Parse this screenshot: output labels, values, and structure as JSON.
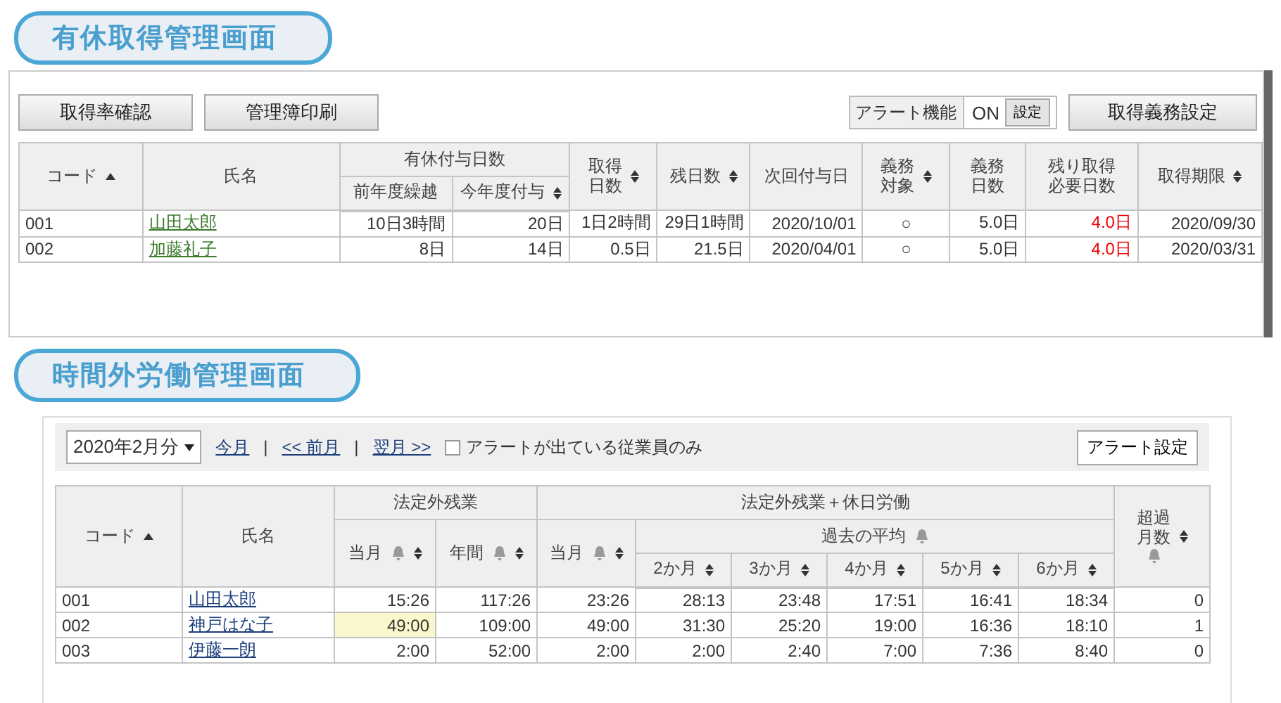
{
  "leave_screen": {
    "title": "有休取得管理画面",
    "buttons": [
      "取得率確認",
      "管理簿印刷"
    ],
    "alert_toggle": {
      "label": "アラート機能",
      "value": "ON",
      "button": "設定"
    },
    "right_button": "取得義務設定",
    "table": {
      "header_rows": [
        [
          {
            "lines": [
              "コード"
            ],
            "rowspan": 2,
            "sortable": true,
            "sorted_ascending": true
          },
          {
            "lines": [
              "氏名"
            ],
            "rowspan": 2,
            "sortable": false,
            "sorted_ascending": false
          },
          {
            "lines": [
              "有休付与日数"
            ],
            "colspan": 2,
            "sortable": false,
            "sorted_ascending": false
          },
          {
            "lines": [
              "取得",
              "日数"
            ],
            "rowspan": 2,
            "sortable": true,
            "sorted_ascending": false
          },
          {
            "lines": [
              "残日数"
            ],
            "rowspan": 2,
            "sortable": true,
            "sorted_ascending": false
          },
          {
            "lines": [
              "次回付与日"
            ],
            "rowspan": 2,
            "sortable": false,
            "sorted_ascending": false
          },
          {
            "lines": [
              "義務",
              "対象"
            ],
            "rowspan": 2,
            "sortable": true,
            "sorted_ascending": false
          },
          {
            "lines": [
              "義務",
              "日数"
            ],
            "rowspan": 2,
            "sortable": false,
            "sorted_ascending": false
          },
          {
            "lines": [
              "残り取得",
              "必要日数"
            ],
            "rowspan": 2,
            "sortable": false,
            "sorted_ascending": false
          },
          {
            "lines": [
              "取得期限"
            ],
            "rowspan": 2,
            "sortable": true,
            "sorted_ascending": false
          }
        ],
        [
          {
            "lines": [
              "前年度繰越"
            ],
            "sortable": false,
            "sorted_ascending": false
          },
          {
            "lines": [
              "今年度付与"
            ],
            "sortable": true,
            "sorted_ascending": false
          }
        ]
      ],
      "rows": [
        [
          {
            "text": "001",
            "kind": "code",
            "alert": false
          },
          {
            "text": "山田太郎",
            "kind": "link",
            "alert": false
          },
          {
            "text": "10日3時間",
            "kind": "num",
            "alert": false
          },
          {
            "text": "20日",
            "kind": "num",
            "alert": false
          },
          {
            "text": "1日2時間",
            "kind": "num",
            "alert": false
          },
          {
            "text": "29日1時間",
            "kind": "num",
            "alert": false
          },
          {
            "text": "2020/10/01",
            "kind": "num",
            "alert": false
          },
          {
            "text": "○",
            "kind": "center",
            "alert": false
          },
          {
            "text": "5.0日",
            "kind": "num",
            "alert": false
          },
          {
            "text": "4.0日",
            "kind": "num",
            "alert": true
          },
          {
            "text": "2020/09/30",
            "kind": "num",
            "alert": false
          }
        ],
        [
          {
            "text": "002",
            "kind": "code",
            "alert": false
          },
          {
            "text": "加藤礼子",
            "kind": "link",
            "alert": false
          },
          {
            "text": "8日",
            "kind": "num",
            "alert": false
          },
          {
            "text": "14日",
            "kind": "num",
            "alert": false
          },
          {
            "text": "0.5日",
            "kind": "num",
            "alert": false
          },
          {
            "text": "21.5日",
            "kind": "num",
            "alert": false
          },
          {
            "text": "2020/04/01",
            "kind": "num",
            "alert": false
          },
          {
            "text": "○",
            "kind": "center",
            "alert": false
          },
          {
            "text": "5.0日",
            "kind": "num",
            "alert": false
          },
          {
            "text": "4.0日",
            "kind": "num",
            "alert": true
          },
          {
            "text": "2020/03/31",
            "kind": "num",
            "alert": false
          }
        ]
      ]
    }
  },
  "overtime_screen": {
    "title": "時間外労働管理画面",
    "month_select": "2020年2月分",
    "nav": [
      {
        "text": "今月",
        "kind": "link"
      },
      {
        "text": "|",
        "kind": "sep"
      },
      {
        "text": "<< 前月",
        "kind": "link"
      },
      {
        "text": "|",
        "kind": "sep"
      },
      {
        "text": "翌月 >>",
        "kind": "link"
      }
    ],
    "alert_only": {
      "label": "アラートが出ている従業員のみ",
      "checked": false
    },
    "right_button": "アラート設定",
    "table": {
      "header_rows": [
        [
          {
            "lines": [
              "コード"
            ],
            "rowspan": 3,
            "sortable": true,
            "sorted_ascending": true,
            "bell": false
          },
          {
            "lines": [
              "氏名"
            ],
            "rowspan": 3,
            "sortable": false,
            "sorted_ascending": false,
            "bell": false
          },
          {
            "lines": [
              "法定外残業"
            ],
            "colspan": 2,
            "sortable": false,
            "sorted_ascending": false,
            "bell": false
          },
          {
            "lines": [
              "法定外残業＋休日労働"
            ],
            "colspan": 6,
            "sortable": false,
            "sorted_ascending": false,
            "bell": false
          },
          {
            "lines": [
              "超過",
              "月数"
            ],
            "rowspan": 3,
            "sortable": true,
            "sorted_ascending": false,
            "bell": true
          }
        ],
        [
          {
            "lines": [
              "当月"
            ],
            "rowspan": 2,
            "sortable": true,
            "sorted_ascending": false,
            "bell": true
          },
          {
            "lines": [
              "年間"
            ],
            "rowspan": 2,
            "sortable": true,
            "sorted_ascending": false,
            "bell": true
          },
          {
            "lines": [
              "当月"
            ],
            "rowspan": 2,
            "sortable": true,
            "sorted_ascending": false,
            "bell": true
          },
          {
            "lines": [
              "過去の平均"
            ],
            "colspan": 5,
            "sortable": false,
            "sorted_ascending": false,
            "bell": true
          }
        ],
        [
          {
            "lines": [
              "2か月"
            ],
            "sortable": true,
            "sorted_ascending": false,
            "bell": false
          },
          {
            "lines": [
              "3か月"
            ],
            "sortable": true,
            "sorted_ascending": false,
            "bell": false
          },
          {
            "lines": [
              "4か月"
            ],
            "sortable": true,
            "sorted_ascending": false,
            "bell": false
          },
          {
            "lines": [
              "5か月"
            ],
            "sortable": true,
            "sorted_ascending": false,
            "bell": false
          },
          {
            "lines": [
              "6か月"
            ],
            "sortable": true,
            "sorted_ascending": false,
            "bell": false
          }
        ]
      ],
      "rows": [
        [
          {
            "text": "001",
            "kind": "code",
            "alert": false
          },
          {
            "text": "山田太郎",
            "kind": "link",
            "alert": false
          },
          {
            "text": "15:26",
            "kind": "num",
            "alert": false
          },
          {
            "text": "117:26",
            "kind": "num",
            "alert": false
          },
          {
            "text": "23:26",
            "kind": "num",
            "alert": false
          },
          {
            "text": "28:13",
            "kind": "num",
            "alert": false
          },
          {
            "text": "23:48",
            "kind": "num",
            "alert": false
          },
          {
            "text": "17:51",
            "kind": "num",
            "alert": false
          },
          {
            "text": "16:41",
            "kind": "num",
            "alert": false
          },
          {
            "text": "18:34",
            "kind": "num",
            "alert": false
          },
          {
            "text": "0",
            "kind": "num",
            "alert": false
          }
        ],
        [
          {
            "text": "002",
            "kind": "code",
            "alert": false
          },
          {
            "text": "神戸はな子",
            "kind": "link",
            "alert": false
          },
          {
            "text": "49:00",
            "kind": "num",
            "alert": true
          },
          {
            "text": "109:00",
            "kind": "num",
            "alert": false
          },
          {
            "text": "49:00",
            "kind": "num",
            "alert": false
          },
          {
            "text": "31:30",
            "kind": "num",
            "alert": false
          },
          {
            "text": "25:20",
            "kind": "num",
            "alert": false
          },
          {
            "text": "19:00",
            "kind": "num",
            "alert": false
          },
          {
            "text": "16:36",
            "kind": "num",
            "alert": false
          },
          {
            "text": "18:10",
            "kind": "num",
            "alert": false
          },
          {
            "text": "1",
            "kind": "num",
            "alert": false
          }
        ],
        [
          {
            "text": "003",
            "kind": "code",
            "alert": false
          },
          {
            "text": "伊藤一朗",
            "kind": "link",
            "alert": false
          },
          {
            "text": "2:00",
            "kind": "num",
            "alert": false
          },
          {
            "text": "52:00",
            "kind": "num",
            "alert": false
          },
          {
            "text": "2:00",
            "kind": "num",
            "alert": false
          },
          {
            "text": "2:00",
            "kind": "num",
            "alert": false
          },
          {
            "text": "2:40",
            "kind": "num",
            "alert": false
          },
          {
            "text": "7:00",
            "kind": "num",
            "alert": false
          },
          {
            "text": "7:36",
            "kind": "num",
            "alert": false
          },
          {
            "text": "8:40",
            "kind": "num",
            "alert": false
          },
          {
            "text": "0",
            "kind": "num",
            "alert": false
          }
        ]
      ]
    }
  }
}
